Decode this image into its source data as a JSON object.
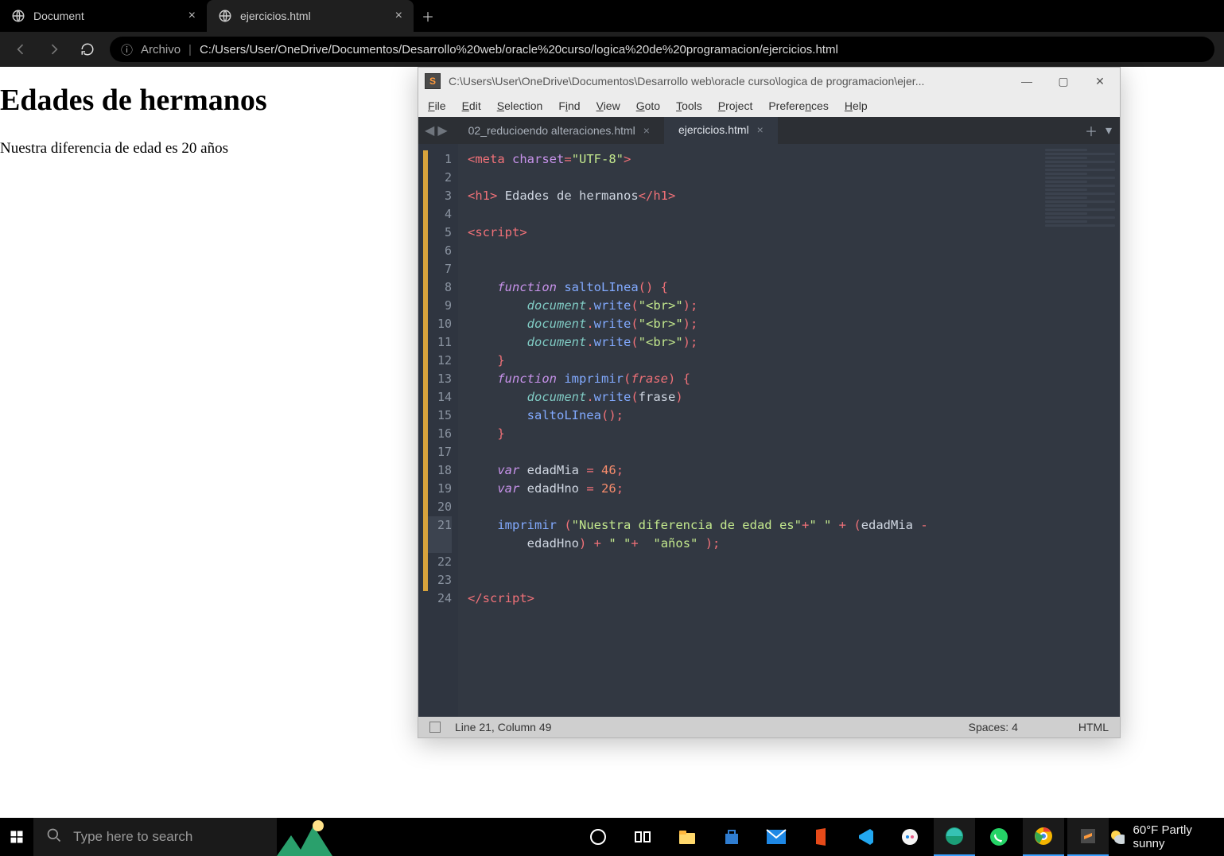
{
  "browser": {
    "tabs": [
      {
        "title": "Document",
        "active": false
      },
      {
        "title": "ejercicios.html",
        "active": true
      }
    ],
    "url_protocol": "Archivo",
    "url_path": "C:/Users/User/OneDrive/Documentos/Desarrollo%20web/oracle%20curso/logica%20de%20programacion/ejercicios.html"
  },
  "page": {
    "heading": "Edades de hermanos",
    "body_text": "Nuestra diferencia de edad es 20 años"
  },
  "sublime": {
    "title": "C:\\Users\\User\\OneDrive\\Documentos\\Desarrollo web\\oracle curso\\logica de programacion\\ejer...",
    "menus": [
      "File",
      "Edit",
      "Selection",
      "Find",
      "View",
      "Goto",
      "Tools",
      "Project",
      "Preferences",
      "Help"
    ],
    "tabs": [
      {
        "name": "02_reducioendo alteraciones.html",
        "active": false
      },
      {
        "name": "ejercicios.html",
        "active": true
      }
    ],
    "line_numbers": [
      "1",
      "2",
      "3",
      "4",
      "5",
      "6",
      "7",
      "8",
      "9",
      "10",
      "11",
      "12",
      "13",
      "14",
      "15",
      "16",
      "17",
      "18",
      "19",
      "20",
      "21",
      "",
      "22",
      "23",
      "24"
    ],
    "dirty_ranges": [
      [
        1,
        4
      ],
      [
        5,
        24
      ]
    ],
    "status": {
      "cursor": "Line 21, Column 49",
      "spaces": "Spaces: 4",
      "syntax": "HTML"
    },
    "source": {
      "l1_meta": "meta",
      "l1_attr": "charset",
      "l1_val": "\"UTF-8\"",
      "l3_tag": "h1",
      "l3_text": " Edades de hermanos",
      "l5_tag": "script",
      "l8_kw": "function",
      "l8_fn": "saltoLInea",
      "l9_obj": "document",
      "l9_meth": "write",
      "l9_arg": "\"<br>\"",
      "l13_fn": "imprimir",
      "l13_param": "frase",
      "l15_call": "saltoLInea",
      "l18_kw": "var",
      "l18_name": "edadMia",
      "l18_val": "46",
      "l19_name": "edadHno",
      "l19_val": "26",
      "l21_str1": "\"Nuestra diferencia de edad es\"",
      "l21_str2": "\" \"",
      "l21_e1": "edadMia",
      "l21_e2": "edadHno",
      "l21_str3": "\" \"",
      "l21_str4": "\"años\""
    }
  },
  "taskbar": {
    "search_placeholder": "Type here to search",
    "weather": "60°F  Partly sunny"
  }
}
